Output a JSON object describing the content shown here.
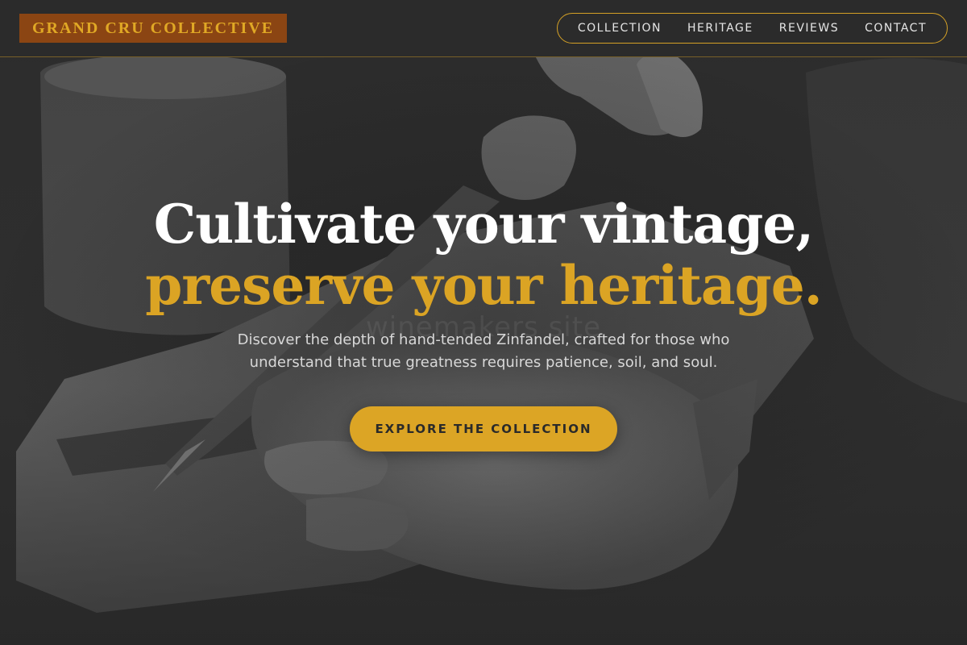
{
  "header": {
    "logo_text": "GRAND CRU COLLECTIVE",
    "nav": [
      {
        "label": "COLLECTION"
      },
      {
        "label": "HERITAGE"
      },
      {
        "label": "REVIEWS"
      },
      {
        "label": "CONTACT"
      }
    ]
  },
  "hero": {
    "headline_line1": "Cultivate your vintage,",
    "headline_line2": "preserve your heritage.",
    "watermark": "winemakers site",
    "subtitle": "Discover the depth of hand-tended Zinfandel, crafted for those who understand that true greatness requires patience, soil, and soul.",
    "cta_label": "EXPLORE THE COLLECTION",
    "background_image": "black-and-white photo of hands carving wood with a chisel"
  },
  "colors": {
    "accent_gold": "#dca525",
    "logo_bg": "#8b4513",
    "header_bg": "#2b2b2b",
    "page_bg": "#2a2a2a"
  }
}
